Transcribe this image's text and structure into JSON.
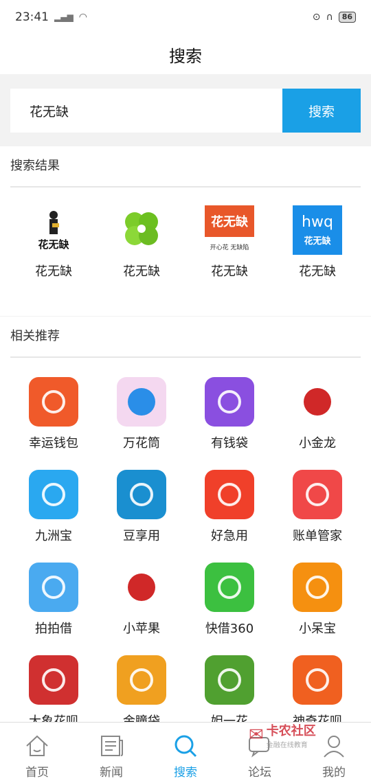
{
  "status": {
    "time": "23:41",
    "battery": "86"
  },
  "header": {
    "title": "搜索"
  },
  "search": {
    "value": "花无缺",
    "button": "搜索"
  },
  "results": {
    "title": "搜索结果",
    "items": [
      {
        "label": "花无缺",
        "icon": "huawuque-man-logo"
      },
      {
        "label": "花无缺",
        "icon": "four-leaf-clover-logo"
      },
      {
        "label": "花无缺",
        "icon": "huawuque-red-banner-logo",
        "icon_text": "花无缺",
        "icon_sub": "开心花 无缺陷"
      },
      {
        "label": "花无缺",
        "icon": "hwq-blue-logo",
        "icon_text": "hwq",
        "icon_sub": "花无缺"
      }
    ]
  },
  "recommend": {
    "title": "相关推荐",
    "items": [
      {
        "label": "幸运钱包",
        "icon": "lucky-wallet-icon",
        "color": "#f05a2a"
      },
      {
        "label": "万花筒",
        "icon": "kaleidoscope-icon",
        "color": "#f4d8f0"
      },
      {
        "label": "有钱袋",
        "icon": "money-bag-icon",
        "color": "#8a4fe0"
      },
      {
        "label": "小金龙",
        "icon": "golden-dragon-icon",
        "color": "#ffffff"
      },
      {
        "label": "九洲宝",
        "icon": "jiuzhou-pinwheel-icon",
        "color": "#2aa8f0"
      },
      {
        "label": "豆享用",
        "icon": "douxiang-icon",
        "color": "#1a8fd0"
      },
      {
        "label": "好急用",
        "icon": "lightning-icon",
        "color": "#f0402a"
      },
      {
        "label": "账单管家",
        "icon": "bill-manager-icon",
        "color": "#f04848"
      },
      {
        "label": "拍拍借",
        "icon": "paipaijie-icon",
        "color": "#4aaaf0"
      },
      {
        "label": "小苹果",
        "icon": "apple-icon",
        "color": "#ffffff"
      },
      {
        "label": "快借360",
        "icon": "yuan-green-icon",
        "color": "#3cc040"
      },
      {
        "label": "小呆宝",
        "icon": "xiaodaibao-icon",
        "color": "#f59010"
      },
      {
        "label": "大象花呗",
        "icon": "elephant-huabei-icon",
        "color": "#d03030"
      },
      {
        "label": "金瞳袋",
        "icon": "golden-eye-icon",
        "color": "#f0a020"
      },
      {
        "label": "妲一花",
        "icon": "green-logo-icon",
        "color": "#50a030"
      },
      {
        "label": "神奇花呗",
        "icon": "magic-huabei-icon",
        "color": "#f06020"
      }
    ]
  },
  "watermark": {
    "title": "卡农社区",
    "sub": "金融在线教育"
  },
  "nav": [
    {
      "label": "首页",
      "icon": "home-icon"
    },
    {
      "label": "新闻",
      "icon": "news-icon"
    },
    {
      "label": "搜索",
      "icon": "search-icon",
      "active": true
    },
    {
      "label": "论坛",
      "icon": "forum-icon"
    },
    {
      "label": "我的",
      "icon": "profile-icon"
    }
  ],
  "colors": {
    "accent": "#1aa0e6"
  }
}
